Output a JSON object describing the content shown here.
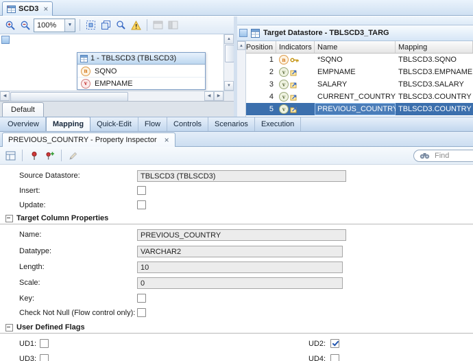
{
  "window_tab": {
    "title": "SCD3"
  },
  "diagram": {
    "toolbar": {
      "zoom_value": "100%"
    },
    "node": {
      "title": "1 - TBLSCD3 (TBLSCD3)",
      "columns": [
        {
          "indicator": "n",
          "name": "SQNO"
        },
        {
          "indicator": "v",
          "name": "EMPNAME"
        }
      ]
    },
    "bottom_tab_label": "Default"
  },
  "datastore": {
    "title": "Target Datastore - TBLSCD3_TARG",
    "columns": [
      "Position",
      "Indicators",
      "Name",
      "Mapping"
    ],
    "rows": [
      {
        "position": "1",
        "indicators": [
          "n",
          "key"
        ],
        "name": "*SQNO",
        "mapping": "TBLSCD3.SQNO",
        "selected": false
      },
      {
        "position": "2",
        "indicators": [
          "v",
          "exec"
        ],
        "name": "EMPNAME",
        "mapping": "TBLSCD3.EMPNAME",
        "selected": false
      },
      {
        "position": "3",
        "indicators": [
          "v",
          "exec"
        ],
        "name": "SALARY",
        "mapping": "TBLSCD3.SALARY",
        "selected": false
      },
      {
        "position": "4",
        "indicators": [
          "v",
          "exec"
        ],
        "name": "CURRENT_COUNTRY",
        "mapping": "TBLSCD3.COUNTRY",
        "selected": false
      },
      {
        "position": "5",
        "indicators": [
          "v",
          "exec"
        ],
        "name": "PREVIOUS_COUNTRY",
        "mapping": "TBLSCD3.COUNTRY",
        "selected": true
      }
    ]
  },
  "main_tabs": {
    "items": [
      "Overview",
      "Mapping",
      "Quick-Edit",
      "Flow",
      "Controls",
      "Scenarios",
      "Execution"
    ],
    "active": "Mapping"
  },
  "inspector": {
    "tab_title": "PREVIOUS_COUNTRY - Property Inspector",
    "find_placeholder": "Find",
    "form": {
      "source_datastore_label": "Source Datastore:",
      "source_datastore_value": "TBLSCD3 (TBLSCD3)",
      "insert_label": "Insert:",
      "insert_checked": false,
      "update_label": "Update:",
      "update_checked": false,
      "target_section_title": "Target Column Properties",
      "name_label": "Name:",
      "name_value": "PREVIOUS_COUNTRY",
      "datatype_label": "Datatype:",
      "datatype_value": "VARCHAR2",
      "length_label": "Length:",
      "length_value": "10",
      "scale_label": "Scale:",
      "scale_value": "0",
      "key_label": "Key:",
      "key_checked": false,
      "check_not_null_label": "Check Not Null (Flow control only):",
      "check_not_null_checked": false,
      "ud_section_title": "User Defined Flags",
      "ud1_label": "UD1:",
      "ud1_checked": false,
      "ud2_label": "UD2:",
      "ud2_checked": true,
      "ud3_label": "UD3:",
      "ud3_checked": false,
      "ud4_label": "UD4:",
      "ud4_checked": false
    }
  },
  "colors": {
    "selection": "#3b6fad",
    "accent_blue": "#3a6bc4",
    "warning_yellow": "#ffd75e"
  }
}
